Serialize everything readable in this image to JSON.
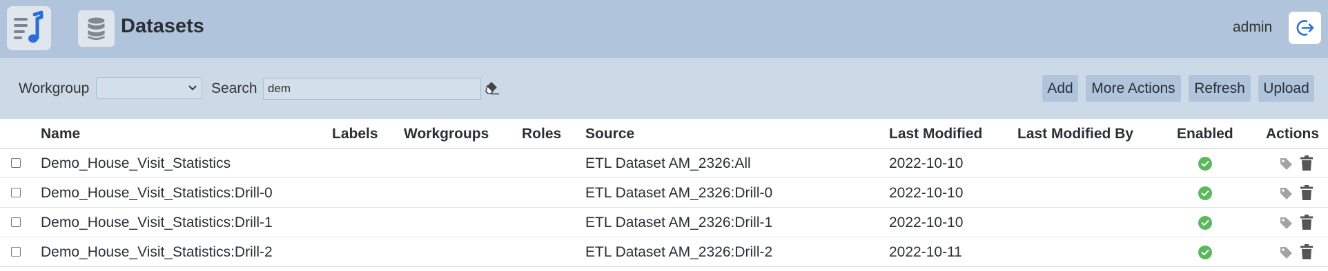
{
  "header": {
    "app_logo_icon": "music-list-icon",
    "title_icon": "database-icon",
    "title": "Datasets",
    "user": "admin",
    "logout_icon": "logout-arrow-icon"
  },
  "toolbar": {
    "workgroup_label": "Workgroup",
    "workgroup_value": "",
    "search_label": "Search",
    "search_value": "dem",
    "clear_icon": "eraser-icon",
    "buttons": [
      "Add",
      "More Actions",
      "Refresh",
      "Upload"
    ]
  },
  "table": {
    "columns": [
      "Name",
      "Labels",
      "Workgroups",
      "Roles",
      "Source",
      "Last Modified",
      "Last Modified By",
      "Enabled",
      "Actions"
    ],
    "rows": [
      {
        "name": "Demo_House_Visit_Statistics",
        "labels": "",
        "workgroups": "",
        "roles": "",
        "source": "ETL Dataset AM_2326:All",
        "last_modified": "2022-10-10",
        "last_modified_by": "",
        "enabled": true
      },
      {
        "name": "Demo_House_Visit_Statistics:Drill-0",
        "labels": "",
        "workgroups": "",
        "roles": "",
        "source": "ETL Dataset AM_2326:Drill-0",
        "last_modified": "2022-10-10",
        "last_modified_by": "",
        "enabled": true
      },
      {
        "name": "Demo_House_Visit_Statistics:Drill-1",
        "labels": "",
        "workgroups": "",
        "roles": "",
        "source": "ETL Dataset AM_2326:Drill-1",
        "last_modified": "2022-10-10",
        "last_modified_by": "",
        "enabled": true
      },
      {
        "name": "Demo_House_Visit_Statistics:Drill-2",
        "labels": "",
        "workgroups": "",
        "roles": "",
        "source": "ETL Dataset AM_2326:Drill-2",
        "last_modified": "2022-10-11",
        "last_modified_by": "",
        "enabled": true
      }
    ],
    "action_icons": [
      "tag-icon",
      "trash-icon"
    ],
    "enabled_icon": "check-circle-icon"
  },
  "colors": {
    "header_bg": "#b0c4db",
    "toolbar_bg": "#ccdae7",
    "enabled_green": "#5cb85c",
    "accent_blue": "#2b6fd6"
  }
}
